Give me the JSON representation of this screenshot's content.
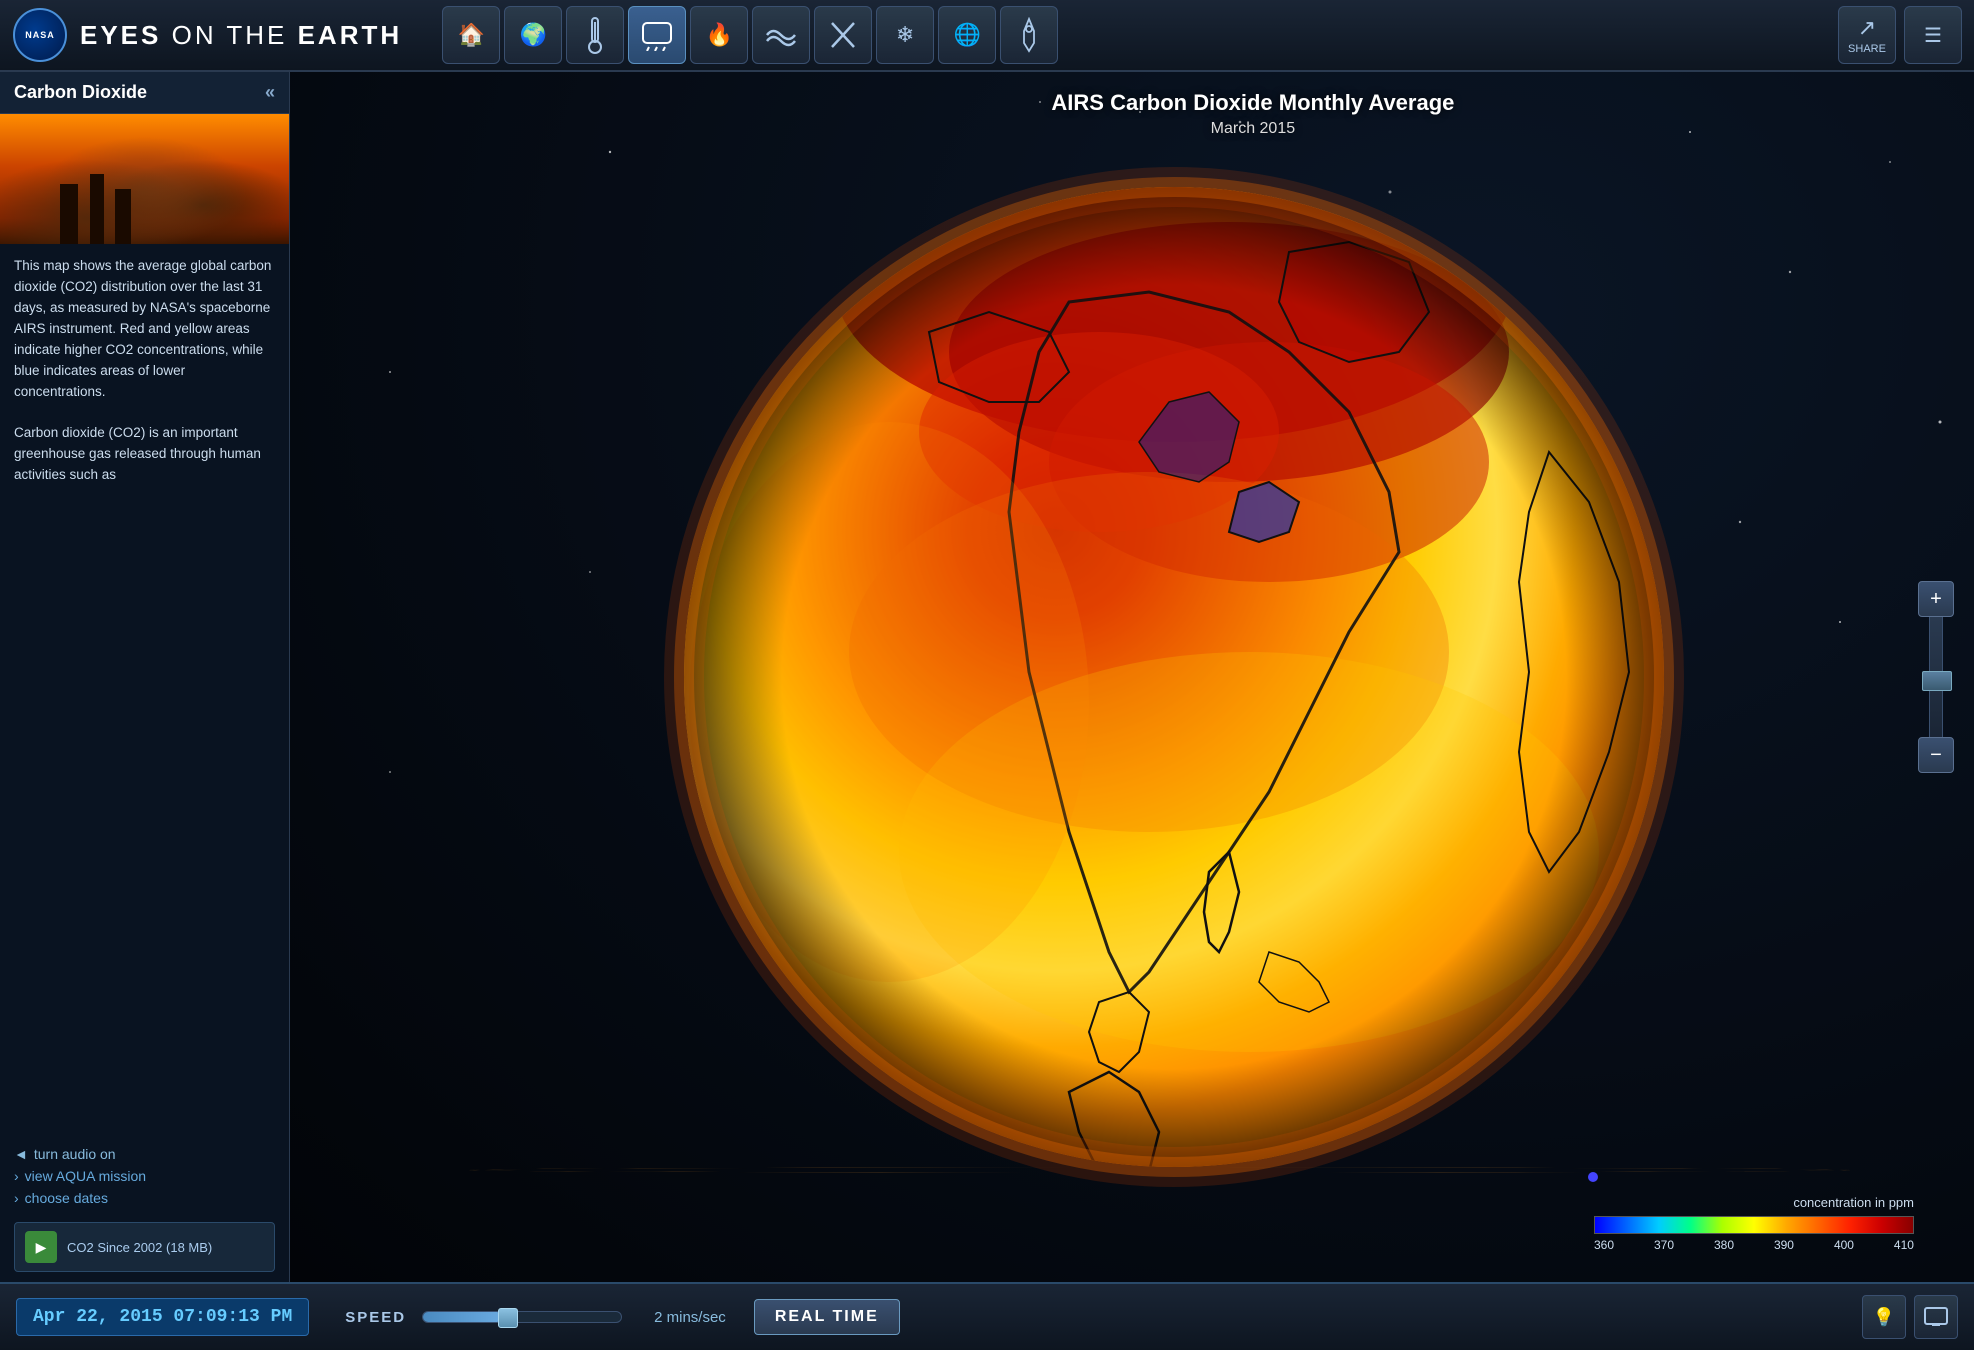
{
  "app": {
    "nasa_label": "NASA",
    "title_eyes": "EYES",
    "title_on": "ON THE",
    "title_earth": "EARTH"
  },
  "header": {
    "nav_buttons": [
      {
        "icon": "🏠",
        "label": "home",
        "active": false
      },
      {
        "icon": "🌍",
        "label": "globe",
        "active": false
      },
      {
        "icon": "🌡",
        "label": "temperature",
        "active": false
      },
      {
        "icon": "💧",
        "label": "precipitation",
        "active": true
      },
      {
        "icon": "🔥",
        "label": "fire",
        "active": false
      },
      {
        "icon": "〰",
        "label": "sea-level",
        "active": false
      },
      {
        "icon": "✂",
        "label": "ozone",
        "active": false
      },
      {
        "icon": "❄",
        "label": "ice",
        "active": false
      },
      {
        "icon": "🌐",
        "label": "carbon",
        "active": false
      },
      {
        "icon": "✏",
        "label": "edit",
        "active": false
      }
    ],
    "share_label": "SHARE",
    "menu_icon": "☰"
  },
  "left_panel": {
    "title": "Carbon Dioxide",
    "collapse_icon": "«",
    "description_part1": "This map shows the average global carbon dioxide (CO2) distribution over the last 31 days, as measured by NASA's spaceborne AIRS instrument. Red and yellow areas indicate higher CO2 concentrations, while blue indicates areas of lower concentrations.",
    "description_part2": "Carbon dioxide (CO2) is an important greenhouse gas released through human activities such as",
    "audio_icon": "◄",
    "audio_label": "turn audio on",
    "view_mission_icon": "›",
    "view_mission_label": "view AQUA mission",
    "choose_dates_icon": "›",
    "choose_dates_label": "choose dates",
    "video_play_icon": "▶",
    "video_label": "CO2 Since 2002 (18 MB)"
  },
  "globe": {
    "title_main": "AIRS Carbon Dioxide Monthly Average",
    "title_sub": "March 2015",
    "orbit_visible": true
  },
  "legend": {
    "title": "concentration in ppm",
    "labels": [
      "360",
      "370",
      "380",
      "390",
      "400",
      "410"
    ]
  },
  "bottom_bar": {
    "datetime": "Apr 22, 2015 07:09:13 PM",
    "speed_label": "SPEED",
    "speed_value": "2 mins/sec",
    "real_time_label": "REAL TIME",
    "light_icon": "💡",
    "screen_icon": "⊞"
  },
  "zoom": {
    "plus": "+",
    "minus": "−"
  }
}
